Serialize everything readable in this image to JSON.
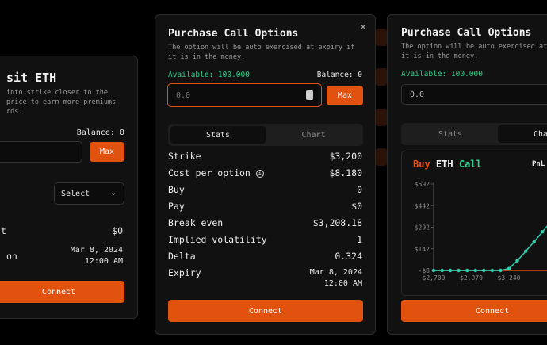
{
  "deposit": {
    "title": "sit ETH",
    "description_1": "into strike closer to the",
    "description_2": "price to earn more premiums",
    "description_3": "rds.",
    "balance": "Balance: 0",
    "max": "Max",
    "select": "Select",
    "row1_label": "t",
    "row1_value": "$0",
    "row2_label": "on",
    "row2_date": "Mar 8, 2024",
    "row2_time": "12:00 AM",
    "connect": "Connect"
  },
  "purchase": {
    "title": "Purchase Call Options",
    "description_1": "The option will be auto exercised at expiry if",
    "description_2": "it is in the money.",
    "available": "Available: 100.000",
    "balance": "Balance: 0",
    "amount_placeholder": "0.0",
    "max": "Max",
    "tabs": [
      "Stats",
      "Chart"
    ],
    "stats": [
      {
        "label": "Strike",
        "value": "$3,200"
      },
      {
        "label": "Cost per option",
        "value": "$8.180"
      },
      {
        "label": "Buy",
        "value": "0"
      },
      {
        "label": "Pay",
        "value": "$0"
      },
      {
        "label": "Break even",
        "value": "$3,208.18"
      },
      {
        "label": "Implied volatility",
        "value": "1"
      },
      {
        "label": "Delta",
        "value": "0.324"
      }
    ],
    "expiry_label": "Expiry",
    "expiry_date": "Mar 8, 2024",
    "expiry_time": "12:00 AM",
    "connect": "Connect",
    "close_icon": "×"
  },
  "chart_panel": {
    "title": "Purchase Call Options",
    "description_1": "The option will be auto exercised at",
    "description_2": "it is in the money.",
    "available": "Available: 100.000",
    "amount_value": "0.0",
    "tabs": [
      "Stats",
      "Cha"
    ],
    "chart_title_buy": "Buy",
    "chart_title_asset": "ETH",
    "chart_title_call": "Call",
    "pnl_label": "PnL",
    "connect": "Connect"
  },
  "chart_data": {
    "type": "line",
    "x_ticks": [
      "$2,700",
      "$2,970",
      "$3,240"
    ],
    "y_ticks": [
      "$592",
      "$442",
      "$292",
      "$142",
      "-$8"
    ],
    "ylim": [
      -8,
      592
    ],
    "grid": false,
    "series": [
      {
        "color": "#2fd1b0",
        "points": [
          [
            2700,
            -8
          ],
          [
            2760,
            -8
          ],
          [
            2820,
            -8
          ],
          [
            2880,
            -8
          ],
          [
            2940,
            -8
          ],
          [
            3000,
            -8
          ],
          [
            3060,
            -8
          ],
          [
            3120,
            -8
          ],
          [
            3180,
            -8
          ],
          [
            3240,
            5
          ],
          [
            3300,
            60
          ],
          [
            3360,
            125
          ],
          [
            3420,
            190
          ],
          [
            3480,
            260
          ],
          [
            3540,
            330
          ],
          [
            3600,
            400
          ],
          [
            3660,
            470
          ],
          [
            3720,
            530
          ]
        ]
      }
    ],
    "breakeven_line": {
      "y": -8,
      "color": "#e2520f"
    }
  },
  "colors": {
    "accent": "#e2520f",
    "green": "#2fd18c",
    "teal": "#2fd1b0"
  }
}
